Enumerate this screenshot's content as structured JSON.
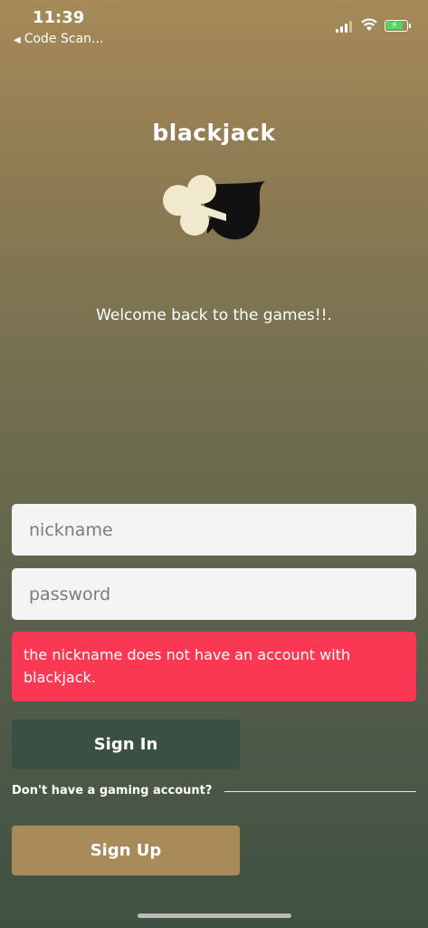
{
  "status_bar": {
    "time": "11:39",
    "back_label": "Code Scan..."
  },
  "app": {
    "title": "blackjack",
    "logo_icons": [
      "club-icon",
      "spade-icon"
    ],
    "welcome": "Welcome back to the games!!."
  },
  "form": {
    "nickname_placeholder": "nickname",
    "nickname_value": "",
    "password_placeholder": "password",
    "password_value": "",
    "error_message": "the nickname does not have an account with blackjack.",
    "sign_in_label": "Sign In",
    "signup_prompt": "Don't have a gaming account?",
    "sign_up_label": "Sign Up"
  },
  "colors": {
    "error": "#fa3854",
    "sign_in_button": "#3a5043",
    "sign_up_button": "#a88b59",
    "battery_fill": "#4cd964",
    "club": "#f1e9cd",
    "spade": "#111111"
  }
}
